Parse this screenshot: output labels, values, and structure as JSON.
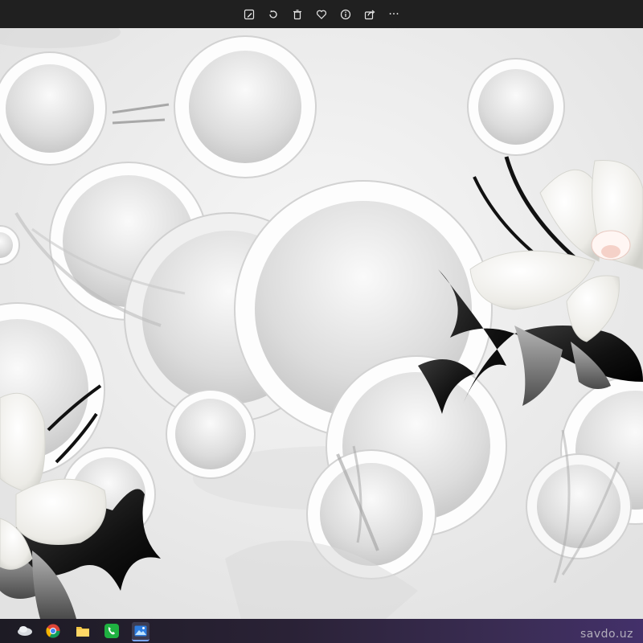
{
  "toolbar": {
    "buttons": [
      {
        "icon": "edit-image-icon"
      },
      {
        "icon": "rotate-icon"
      },
      {
        "icon": "delete-icon"
      },
      {
        "icon": "favorite-heart-icon"
      },
      {
        "icon": "info-icon"
      },
      {
        "icon": "share-icon"
      },
      {
        "icon": "more-options-icon",
        "glyph": "···"
      }
    ]
  },
  "taskbar": {
    "apps": [
      {
        "icon": "cloud-drive-icon"
      },
      {
        "icon": "chrome-browser-icon"
      },
      {
        "icon": "file-explorer-icon"
      },
      {
        "icon": "phone-call-app-icon"
      },
      {
        "icon": "photos-app-icon"
      }
    ]
  },
  "watermark": {
    "text": "savdo.uz"
  },
  "colors": {
    "toolbar_bg": "#202020",
    "canvas_bg": "#f4f4f4",
    "taskbar_accent": "#43306a"
  }
}
